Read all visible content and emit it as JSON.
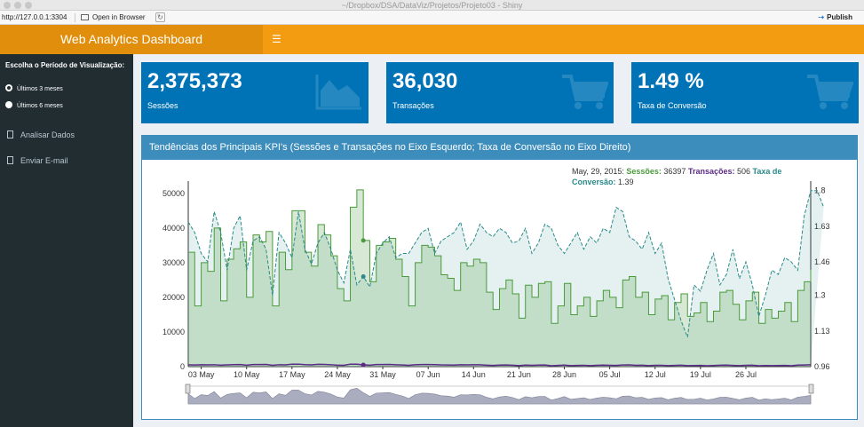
{
  "browser": {
    "window_title": "~/Dropbox/DSA/DataViz/Projetos/Projeto03 - Shiny",
    "url": "http://127.0.0.1:3304",
    "open_in_browser": "Open in Browser",
    "publish": "Publish"
  },
  "header": {
    "title": "Web Analytics Dashboard",
    "menu_icon": "hamburger-icon"
  },
  "sidebar": {
    "period_label": "Escolha o Período de Visualização:",
    "options": [
      {
        "label": "Últimos 3 meses",
        "selected": true
      },
      {
        "label": "Últimos 6 meses",
        "selected": false
      }
    ],
    "menu": [
      {
        "label": "Analisar Dados",
        "icon": "document-icon"
      },
      {
        "label": "Enviar E-mail",
        "icon": "document-icon"
      }
    ]
  },
  "value_boxes": [
    {
      "value": "2,375,373",
      "label": "Sessões",
      "icon": "area-chart-icon"
    },
    {
      "value": "36,030",
      "label": "Transações",
      "icon": "shopping-cart-icon"
    },
    {
      "value": "1.49 %",
      "label": "Taxa de Conversão",
      "icon": "shopping-cart-icon"
    }
  ],
  "colors": {
    "header": "#f39c12",
    "logo": "#e08e0b",
    "sidebar": "#222d32",
    "box": "#0073b7",
    "panel": "#3c8dbc",
    "sessions": "#4a9a3a",
    "transactions": "#5b2a86",
    "conversion": "#2a8a8a"
  },
  "chart_panel": {
    "title": "Tendências dos Principais KPI's (Sessões e Transações no Eixo Esquerdo; Taxa de Conversão no Eixo Direito)"
  },
  "chart_data": {
    "type": "area",
    "x_tick_labels": [
      "03 May",
      "10 May",
      "17 May",
      "24 May",
      "31 May",
      "07 Jun",
      "14 Jun",
      "21 Jun",
      "28 Jun",
      "05 Jul",
      "12 Jul",
      "19 Jul",
      "26 Jul"
    ],
    "start_date": "2015-05-01",
    "ylim_left": [
      0,
      52000
    ],
    "y_ticks_left": [
      0,
      10000,
      20000,
      30000,
      40000,
      50000
    ],
    "ylim_right": [
      0.96,
      1.82
    ],
    "y_ticks_right": [
      "0.96",
      "1.13",
      "1.3",
      "1.46",
      "1.63",
      "1.8"
    ],
    "legend": {
      "date": "May, 29, 2015:",
      "sessions_label": "Sessões:",
      "sessions_value": "36397",
      "transactions_label": "Transações:",
      "transactions_value": "506",
      "conversion_label": "Taxa de Conversão:",
      "conversion_value": "1.39"
    },
    "series": [
      {
        "name": "Sessões",
        "values": [
          33000,
          17500,
          30000,
          27500,
          40000,
          19000,
          31000,
          34000,
          36000,
          20000,
          38000,
          36000,
          39000,
          17500,
          33000,
          28000,
          45000,
          45000,
          33000,
          29000,
          41000,
          38000,
          32000,
          22500,
          19000,
          46000,
          51000,
          36397,
          24500,
          35000,
          36000,
          37000,
          31000,
          26000,
          17500,
          30000,
          35000,
          34500,
          32000,
          26500,
          25500,
          22000,
          30000,
          29000,
          31000,
          30000,
          21500,
          16500,
          22500,
          25000,
          21000,
          14000,
          23500,
          20000,
          24000,
          24500,
          12500,
          17500,
          24000,
          15000,
          17500,
          20000,
          14500,
          19000,
          22000,
          20000,
          17000,
          25000,
          26000,
          20000,
          21500,
          15000,
          19500,
          20500,
          13500,
          18500,
          21000,
          14500,
          15500,
          18500,
          13000,
          16000,
          21500,
          22000,
          18000,
          13500,
          19000,
          21500,
          12500,
          16500,
          14000,
          16000,
          18500,
          13000,
          22000,
          24500,
          28000
        ]
      },
      {
        "name": "Transações",
        "values": [
          520,
          480,
          540,
          510,
          560,
          430,
          520,
          580,
          600,
          420,
          620,
          600,
          640,
          380,
          560,
          520,
          720,
          720,
          580,
          500,
          680,
          650,
          560,
          420,
          380,
          720,
          700,
          506,
          420,
          600,
          620,
          640,
          560,
          480,
          380,
          540,
          620,
          600,
          580,
          500,
          480,
          440,
          540,
          520,
          560,
          540,
          420,
          340,
          440,
          480,
          420,
          300,
          460,
          400,
          460,
          480,
          260,
          340,
          460,
          300,
          340,
          400,
          300,
          380,
          440,
          400,
          340,
          480,
          500,
          400,
          420,
          300,
          380,
          400,
          280,
          360,
          420,
          300,
          320,
          360,
          260,
          320,
          420,
          440,
          360,
          280,
          380,
          420,
          260,
          320,
          280,
          320,
          360,
          260,
          440,
          480,
          540
        ]
      },
      {
        "name": "Taxa de Conversão",
        "values": [
          1.65,
          1.6,
          1.5,
          1.46,
          1.7,
          1.6,
          1.42,
          1.62,
          1.68,
          1.42,
          1.56,
          1.58,
          1.52,
          1.3,
          1.6,
          1.55,
          1.48,
          1.7,
          1.52,
          1.45,
          1.55,
          1.6,
          1.52,
          1.42,
          1.36,
          1.52,
          1.35,
          1.39,
          1.34,
          1.5,
          1.55,
          1.58,
          1.48,
          1.5,
          1.5,
          1.55,
          1.6,
          1.62,
          1.5,
          1.56,
          1.58,
          1.6,
          1.65,
          1.52,
          1.56,
          1.64,
          1.6,
          1.58,
          1.62,
          1.6,
          1.55,
          1.56,
          1.62,
          1.5,
          1.55,
          1.64,
          1.62,
          1.54,
          1.5,
          1.55,
          1.6,
          1.52,
          1.58,
          1.55,
          1.62,
          1.6,
          1.72,
          1.7,
          1.58,
          1.56,
          1.52,
          1.6,
          1.5,
          1.55,
          1.38,
          1.28,
          1.18,
          1.1,
          1.35,
          1.32,
          1.42,
          1.5,
          1.35,
          1.4,
          1.52,
          1.38,
          1.46,
          1.35,
          1.2,
          1.3,
          1.42,
          1.4,
          1.48,
          1.46,
          1.42,
          1.68,
          1.8,
          1.8,
          1.72
        ]
      }
    ]
  }
}
